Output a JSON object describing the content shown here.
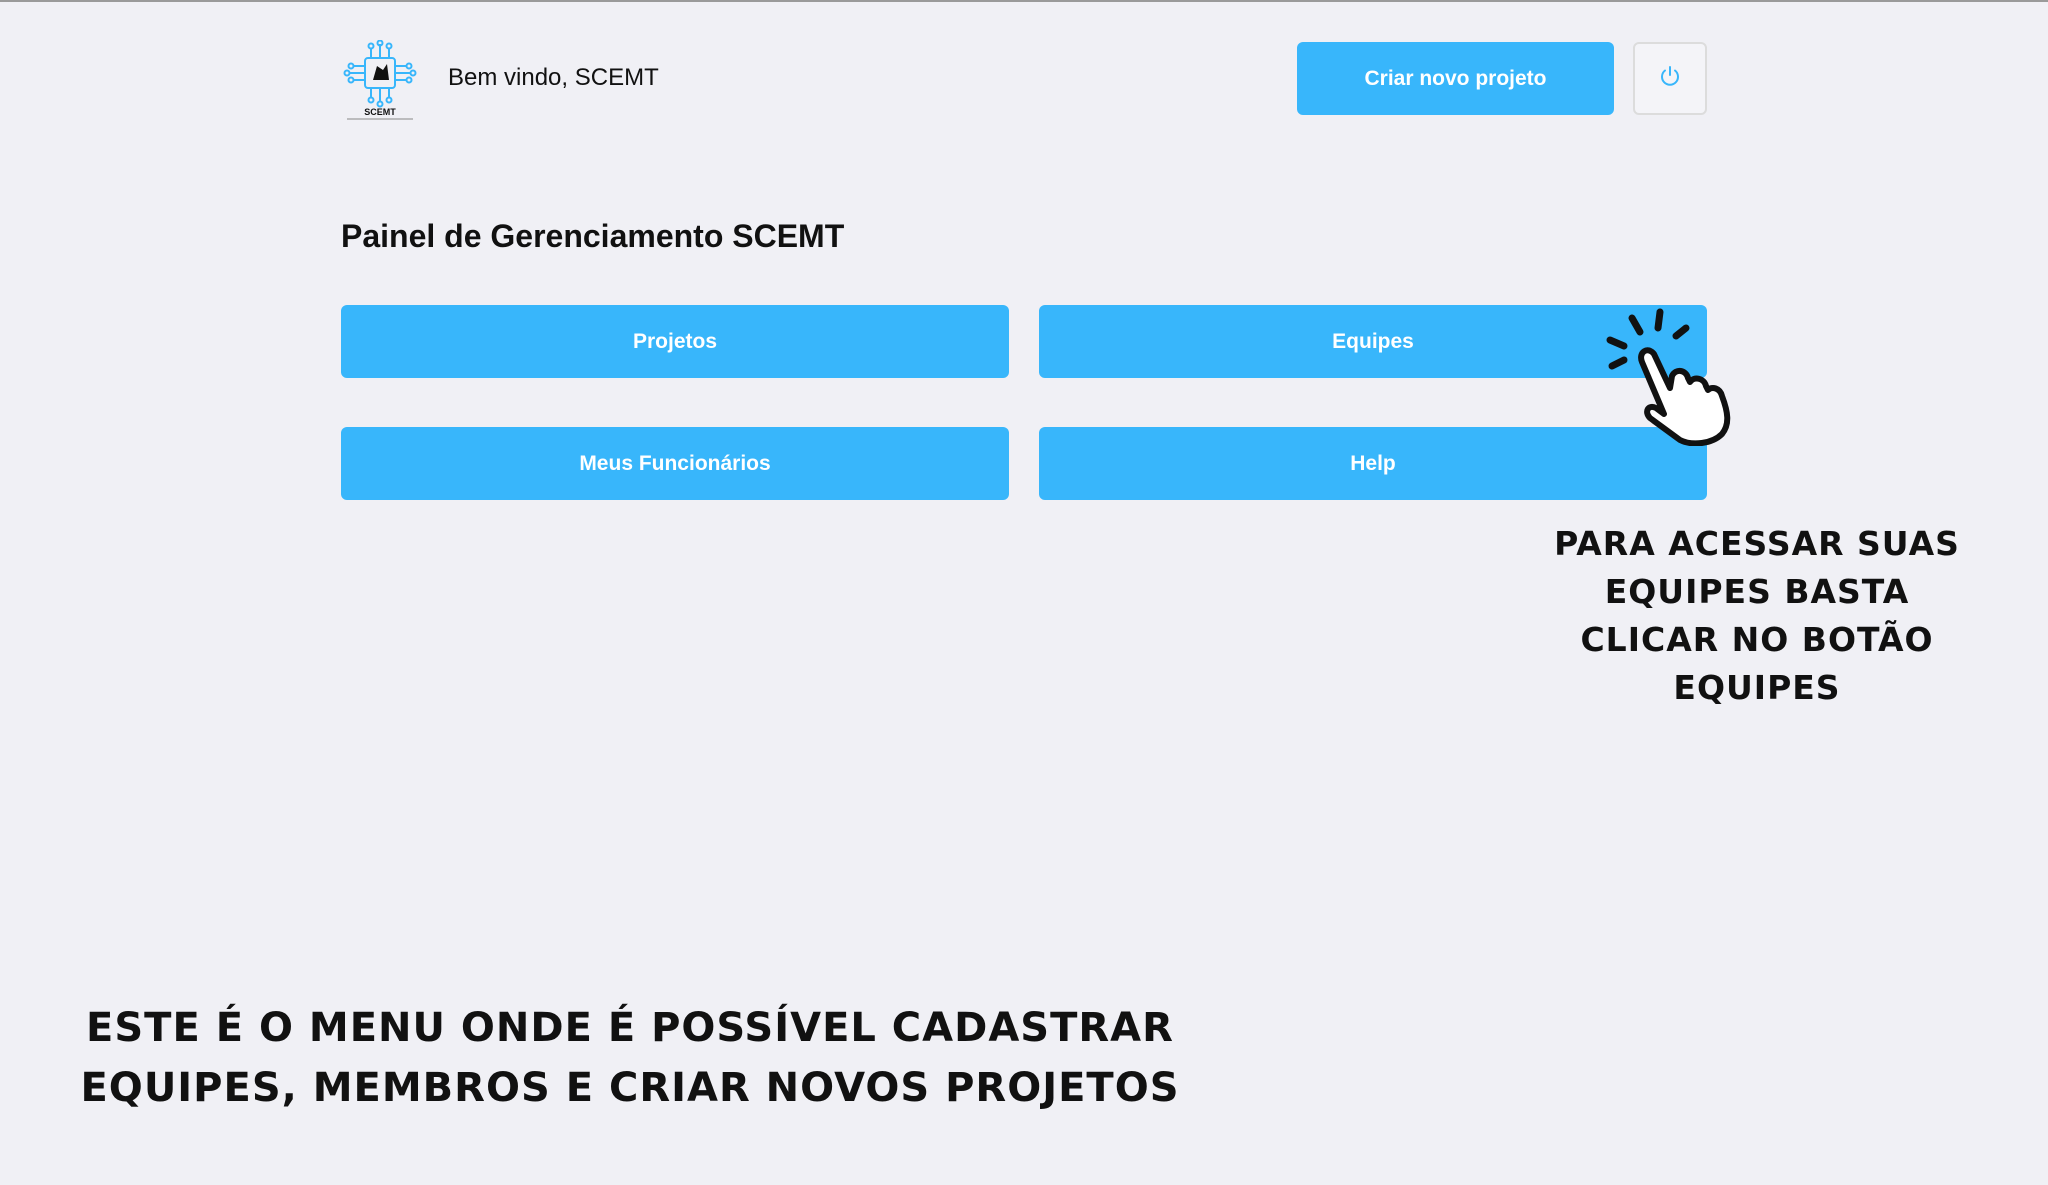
{
  "header": {
    "logo_text": "SCEMT",
    "welcome": "Bem vindo, SCEMT",
    "new_project_label": "Criar novo projeto",
    "power_icon": "power-icon"
  },
  "panel": {
    "title": "Painel de Gerenciamento SCEMT",
    "buttons": [
      {
        "label": "Projetos"
      },
      {
        "label": "Equipes"
      },
      {
        "label": "Meus Funcionários"
      },
      {
        "label": "Help"
      }
    ]
  },
  "annotations": {
    "right": "Para acessar suas equipes basta clicar no botão equipes",
    "bottom_line1": "Este é o menu onde é possível cadastrar",
    "bottom_line2": "equipes, membros e criar novos projetos",
    "pointer_icon": "hand-pointer-icon"
  },
  "colors": {
    "accent": "#38b6fb",
    "background": "#f0f0f5",
    "button_text": "#ffffff"
  }
}
